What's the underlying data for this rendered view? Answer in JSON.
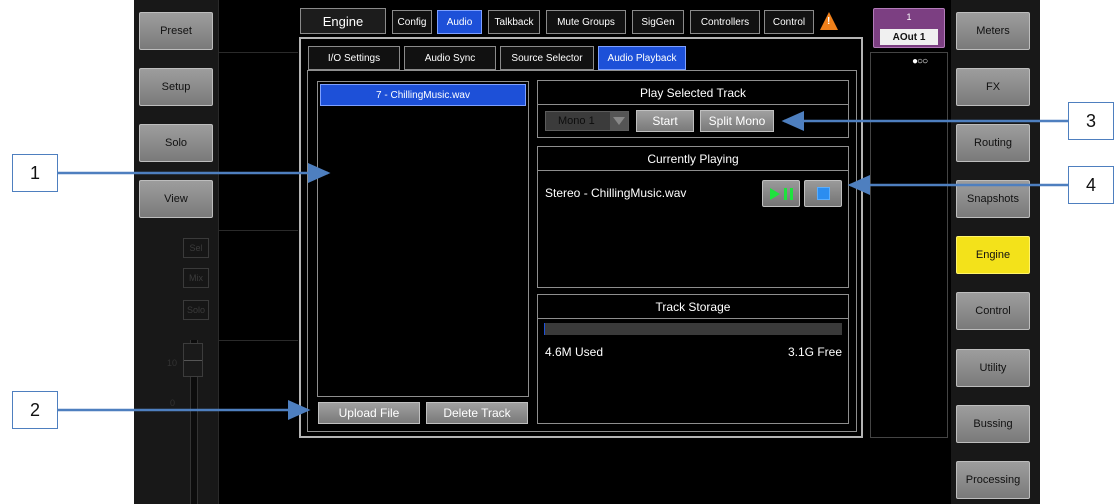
{
  "left_nav": {
    "preset": "Preset",
    "setup": "Setup",
    "solo": "Solo",
    "view": "View"
  },
  "strip": {
    "sel": "Sel",
    "mix": "Mix",
    "solo": "Solo",
    "scale_10": "10",
    "scale_0": "0"
  },
  "top_tabs": {
    "engine_title": "Engine",
    "tabs": [
      "Config",
      "Audio",
      "Talkback",
      "Mute Groups",
      "SigGen",
      "Controllers",
      "Control"
    ],
    "active_tab": "Audio",
    "warning_icon": "warning-triangle-icon",
    "warning_glyph": "!"
  },
  "output": {
    "number": "1",
    "name": "AOut 1",
    "page_dots": "●○○"
  },
  "sub_tabs": {
    "tabs": [
      "I/O Settings",
      "Audio Sync",
      "Source Selector",
      "Audio Playback"
    ],
    "active_tab": "Audio Playback"
  },
  "track_list": {
    "items": [
      "7 - ChillingMusic.wav"
    ],
    "selected": "7 - ChillingMusic.wav"
  },
  "buttons": {
    "upload": "Upload File",
    "delete": "Delete Track"
  },
  "play_selected": {
    "heading": "Play Selected Track",
    "mode_value": "Mono 1",
    "start": "Start",
    "split_mono": "Split Mono"
  },
  "currently_playing": {
    "heading": "Currently Playing",
    "track": "Stereo - ChillingMusic.wav",
    "play_pause_icon": "play-pause-icon",
    "stop_icon": "stop-icon"
  },
  "storage": {
    "heading": "Track Storage",
    "used": "4.6M Used",
    "free": "3.1G Free",
    "used_fraction": 0.0015
  },
  "right_nav": {
    "meters": "Meters",
    "fx": "FX",
    "routing": "Routing",
    "snapshots": "Snapshots",
    "engine": "Engine",
    "control": "Control",
    "utility": "Utility",
    "bussing": "Bussing",
    "processing": "Processing",
    "active": "Engine"
  },
  "callouts": [
    "1",
    "2",
    "3",
    "4"
  ],
  "colors": {
    "accent_blue": "#1d50d8",
    "active_yellow": "#f3e21a",
    "output_purple": "#7c3f82",
    "callout_line": "#4e7fbf",
    "warning_orange": "#f0801a",
    "play_green": "#1ee33d",
    "stop_blue": "#2b8df0"
  }
}
